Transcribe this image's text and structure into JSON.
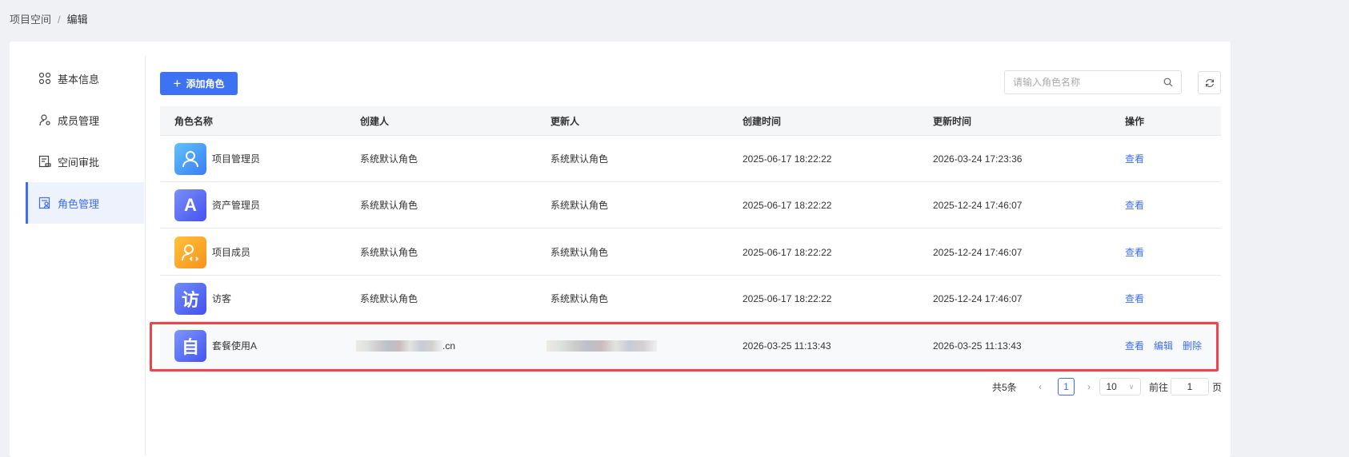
{
  "breadcrumb": {
    "root": "项目空间",
    "separator": "/",
    "current": "编辑"
  },
  "sidebar": {
    "items": [
      {
        "label": "基本信息",
        "icon": "grid-icon"
      },
      {
        "label": "成员管理",
        "icon": "user-gear-icon"
      },
      {
        "label": "空间审批",
        "icon": "approval-icon"
      },
      {
        "label": "角色管理",
        "icon": "role-icon",
        "active": true
      }
    ]
  },
  "toolbar": {
    "add_label": "添加角色",
    "search_placeholder": "请输入角色名称"
  },
  "table": {
    "headers": [
      "角色名称",
      "创建人",
      "更新人",
      "创建时间",
      "更新时间",
      "操作"
    ],
    "rows": [
      {
        "name": "项目管理员",
        "icon_text": "",
        "creator": "系统默认角色",
        "updater": "系统默认角色",
        "created": "2025-06-17 18:22:22",
        "updated": "2026-03-24 17:23:36",
        "actions": [
          "查看"
        ]
      },
      {
        "name": "资产管理员",
        "icon_text": "A",
        "creator": "系统默认角色",
        "updater": "系统默认角色",
        "created": "2025-06-17 18:22:22",
        "updated": "2025-12-24 17:46:07",
        "actions": [
          "查看"
        ]
      },
      {
        "name": "项目成员",
        "icon_text": "",
        "creator": "系统默认角色",
        "updater": "系统默认角色",
        "created": "2025-06-17 18:22:22",
        "updated": "2025-12-24 17:46:07",
        "actions": [
          "查看"
        ]
      },
      {
        "name": "访客",
        "icon_text": "访",
        "creator": "系统默认角色",
        "updater": "系统默认角色",
        "created": "2025-06-17 18:22:22",
        "updated": "2025-12-24 17:46:07",
        "actions": [
          "查看"
        ]
      },
      {
        "name": "套餐使用A",
        "icon_text": "自",
        "creator": ".cn",
        "updater": "",
        "created": "2026-03-25 11:13:43",
        "updated": "2026-03-25 11:13:43",
        "actions": [
          "查看",
          "编辑",
          "删除"
        ]
      }
    ]
  },
  "pagination": {
    "total": "共5条",
    "current_page": "1",
    "page_size": "10",
    "goto_label": "前往",
    "goto_value": "1",
    "page_suffix": "页"
  }
}
